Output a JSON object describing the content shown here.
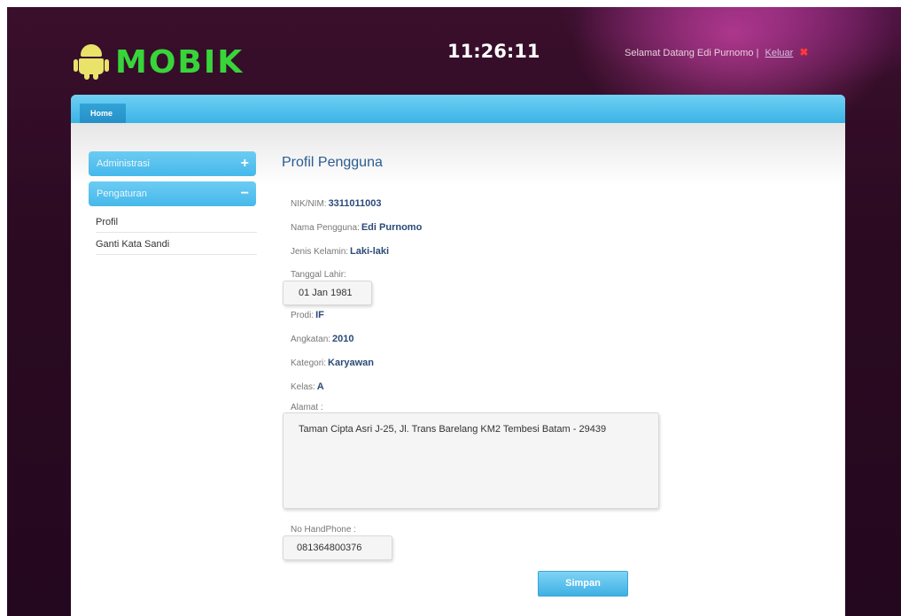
{
  "header": {
    "logo_text": "MOBIK",
    "clock": "11:26:11",
    "greeting": "Selamat Datang Edi Purnomo |",
    "logout_label": "Keluar",
    "logout_icon": "close-icon"
  },
  "nav": {
    "tabs": [
      {
        "label": "Home"
      }
    ]
  },
  "sidebar": {
    "sections": [
      {
        "label": "Administrasi",
        "sign": "+"
      },
      {
        "label": "Pengaturan",
        "sign": "−"
      }
    ],
    "items": [
      {
        "label": "Profil"
      },
      {
        "label": "Ganti Kata Sandi"
      }
    ]
  },
  "profile": {
    "title": "Profil Pengguna",
    "nik_label": "NIK/NIM:",
    "nik_value": "3311011003",
    "nama_label": "Nama Pengguna:",
    "nama_value": "Edi Purnomo",
    "jk_label": "Jenis Kelamin:",
    "jk_value": "Laki-laki",
    "tgl_label": "Tanggal Lahir:",
    "tgl_value": "01 Jan 1981",
    "prodi_label": "Prodi:",
    "prodi_value": "IF",
    "angkatan_label": "Angkatan:",
    "angkatan_value": "2010",
    "kategori_label": "Kategori:",
    "kategori_value": "Karyawan",
    "kelas_label": "Kelas:",
    "kelas_value": "A",
    "alamat_label": "Alamat :",
    "alamat_value": "Taman Cipta Asri J-25, Jl. Trans Barelang KM2 Tembesi Batam - 29439",
    "hp_label": "No HandPhone :",
    "hp_value": "081364800376",
    "save_label": "Simpan"
  },
  "colors": {
    "brand_green": "#37d53a",
    "accent_blue": "#45b8ea",
    "header_bg": "#2a0a21"
  }
}
